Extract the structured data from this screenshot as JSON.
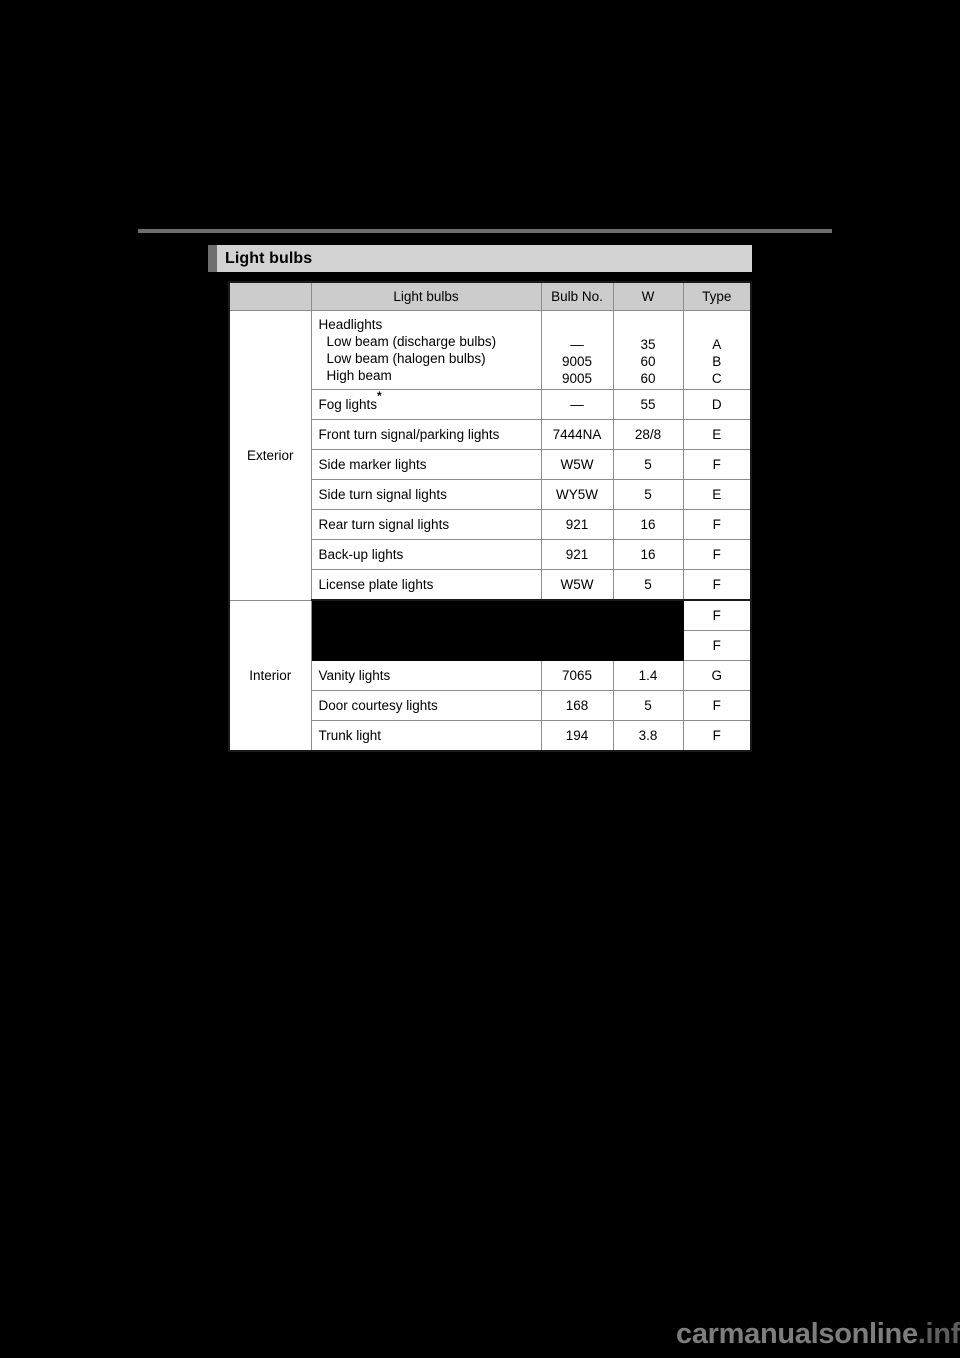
{
  "page": {
    "background_color": "#000000",
    "rule_color": "#6e6e6e"
  },
  "section": {
    "title": "Light bulbs",
    "accent_color": "#6e6e6e",
    "fill_color": "#d2d2d2"
  },
  "table": {
    "header_fill": "#cccccc",
    "border_color": "#8c8c8c",
    "columns": [
      "",
      "Light bulbs",
      "Bulb No.",
      "W",
      "Type"
    ],
    "groups": [
      {
        "category": "Exterior",
        "rows": [
          {
            "type": "multiline",
            "name_lines": [
              "Headlights",
              "Low beam (discharge bulbs)",
              "Low beam (halogen bulbs)",
              "High beam"
            ],
            "bulb_lines": [
              "",
              "—",
              "9005",
              "9005"
            ],
            "watt_lines": [
              "",
              "35",
              "60",
              "60"
            ],
            "type_lines": [
              "",
              "A",
              "B",
              "C"
            ]
          },
          {
            "type": "normal",
            "name": "Fog lights",
            "asterisk": "*",
            "bulb": "—",
            "watt": "55",
            "bulb_type": "D"
          },
          {
            "type": "normal",
            "name": "Front turn signal/parking lights",
            "bulb": "7444NA",
            "watt": "28/8",
            "bulb_type": "E"
          },
          {
            "type": "normal",
            "name": "Side marker lights",
            "bulb": "W5W",
            "watt": "5",
            "bulb_type": "F"
          },
          {
            "type": "normal",
            "name": "Side turn signal lights",
            "bulb": "WY5W",
            "watt": "5",
            "bulb_type": "E"
          },
          {
            "type": "normal",
            "name": "Rear turn signal lights",
            "bulb": "921",
            "watt": "16",
            "bulb_type": "F"
          },
          {
            "type": "normal",
            "name": "Back-up lights",
            "bulb": "921",
            "watt": "16",
            "bulb_type": "F"
          },
          {
            "type": "normal",
            "name": "License plate lights",
            "bulb": "W5W",
            "watt": "5",
            "bulb_type": "F"
          }
        ]
      },
      {
        "category": "Interior",
        "rows": [
          {
            "type": "redacted",
            "name": "",
            "bulb": "",
            "watt": "",
            "bulb_type": "F"
          },
          {
            "type": "redacted",
            "name": "",
            "bulb": "",
            "watt": "",
            "bulb_type": "F"
          },
          {
            "type": "normal",
            "name": "Vanity lights",
            "bulb": "7065",
            "watt": "1.4",
            "bulb_type": "G"
          },
          {
            "type": "normal",
            "name": "Door courtesy lights",
            "bulb": "168",
            "watt": "5",
            "bulb_type": "F"
          },
          {
            "type": "normal",
            "name": "Trunk light",
            "bulb": "194",
            "watt": "3.8",
            "bulb_type": "F"
          }
        ]
      }
    ]
  },
  "watermark": {
    "primary": "carmanualsonline",
    "suffix": ".info"
  }
}
